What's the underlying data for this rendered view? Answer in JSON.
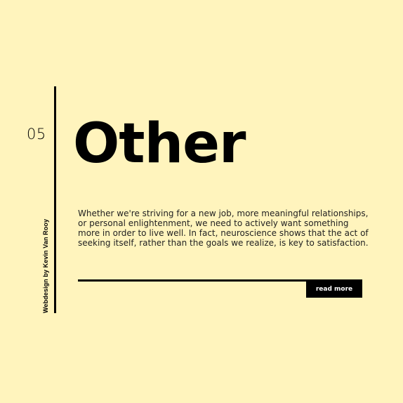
{
  "section": {
    "number": "05",
    "title": "Other",
    "description": "Whether we're striving for a new job, more meaningful relationships, or personal enlightenment, we need to actively want something more in order to live well. In fact, neuroscience shows that the act of seeking itself, rather than the goals we realize, is key to satisfaction."
  },
  "credit": "Webdesign by Kevin Van Rooy",
  "actions": {
    "read_more_label": "read more"
  }
}
